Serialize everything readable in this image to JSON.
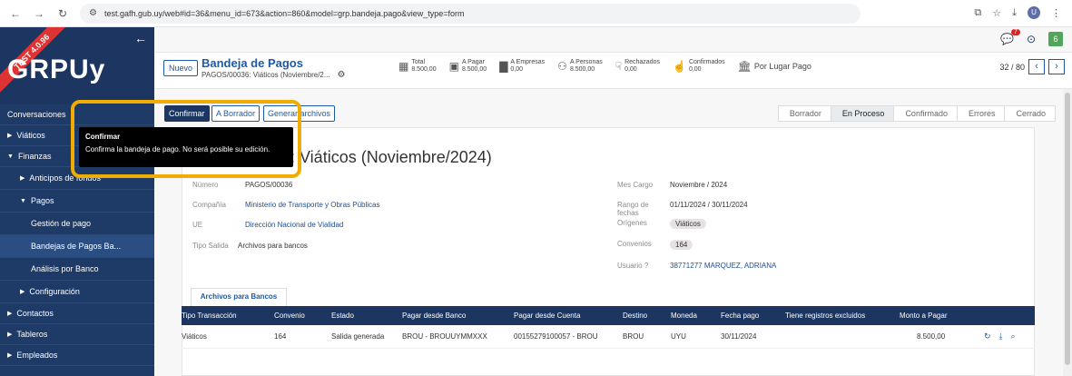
{
  "browser": {
    "url": "test.gafh.gub.uy/web#id=36&menu_id=673&action=860&model=grp.bandeja.pago&view_type=form",
    "profile_initial": "U"
  },
  "sidebar": {
    "ribbon": "TEST 4.0.96",
    "logo": "GRPUy",
    "items": [
      {
        "label": "Conversaciones"
      },
      {
        "label": "Viáticos"
      },
      {
        "label": "Finanzas"
      },
      {
        "label": "Anticipos de fondos"
      },
      {
        "label": "Pagos"
      },
      {
        "label": "Gestión de pago"
      },
      {
        "label": "Bandejas de Pagos Ba..."
      },
      {
        "label": "Análisis por Banco"
      },
      {
        "label": "Configuración"
      },
      {
        "label": "Contactos"
      },
      {
        "label": "Tableros"
      },
      {
        "label": "Empleados"
      }
    ]
  },
  "topbar": {
    "chat_badge": "7",
    "user_badge": "6"
  },
  "control": {
    "new_label": "Nuevo",
    "title": "Bandeja de Pagos",
    "subtitle": "PAGOS/00036: Viáticos (Noviembre/2...",
    "stats": [
      {
        "label": "Total",
        "value": "8.500,00"
      },
      {
        "label": "A Pagar",
        "value": "8.500,00"
      },
      {
        "label": "A Empresas",
        "value": "0,00"
      },
      {
        "label": "A Personas",
        "value": "8.500,00"
      },
      {
        "label": "Rechazados",
        "value": "0,00"
      },
      {
        "label": "Confirmados",
        "value": "0,00"
      },
      {
        "label": "Por Lugar Pago",
        "value": ""
      }
    ],
    "pager": "32 / 80"
  },
  "actions": {
    "confirm": "Confirmar",
    "draft": "A Borrador",
    "generate": "Generar archivos"
  },
  "steps": [
    "Borrador",
    "En Proceso",
    "Confirmado",
    "Errores",
    "Cerrado"
  ],
  "tooltip": {
    "title": "Confirmar",
    "body": "Confirma la bandeja de pago. No será posible su edición."
  },
  "form": {
    "title": ": Viáticos (Noviembre/2024)",
    "numero_label": "Número",
    "numero": "PAGOS/00036",
    "compania_label": "Compañía",
    "compania": "Ministerio de Transporte y Obras Públicas",
    "ue_label": "UE",
    "ue": "Dirección Nacional de Vialidad",
    "tipo_label": "Tipo Salida",
    "tipo": "Archivos para bancos",
    "mes_label": "Mes Cargo",
    "mes": "Noviembre / 2024",
    "rango_label": "Rango de fechas",
    "rango": "01/11/2024 / 30/11/2024",
    "origenes_label": "Orígenes",
    "origenes": "Viáticos",
    "convenios_label": "Convenios",
    "convenios": "164",
    "usuario_label": "Usuario ?",
    "usuario": "38771277 MARQUEZ, ADRIANA"
  },
  "tab": "Archivos para Bancos",
  "table": {
    "headers": [
      "Tipo Transacción",
      "Convenio",
      "Estado",
      "Pagar desde Banco",
      "Pagar desde Cuenta",
      "Destino",
      "Moneda",
      "Fecha pago",
      "Tiene registros excluidos",
      "Monto a Pagar"
    ],
    "row": [
      "Viáticos",
      "164",
      "Salida generada",
      "BROU - BROUUYMMXXX",
      "00155279100057 - BROU",
      "BROU",
      "UYU",
      "30/11/2024",
      "",
      "8.500,00"
    ]
  }
}
